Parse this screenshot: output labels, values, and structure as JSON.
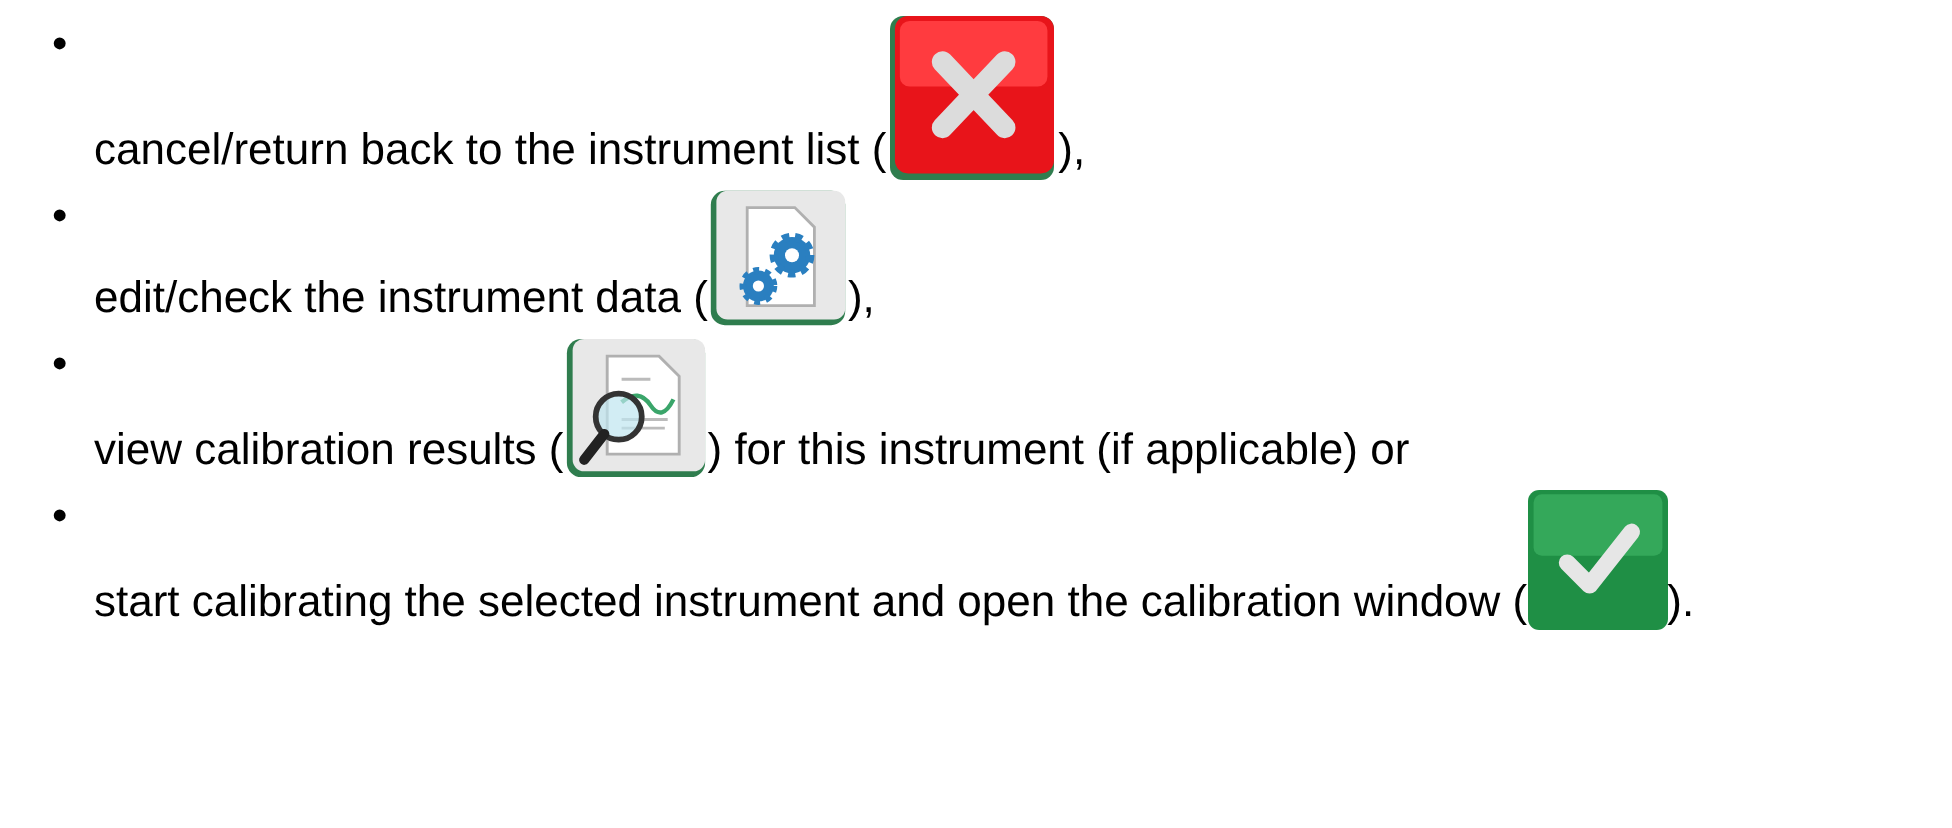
{
  "items": [
    {
      "text_before": "cancel/return back to the instrument list (",
      "icon": {
        "kind": "cancel"
      },
      "text_after": "),"
    },
    {
      "text_before": "edit/check the instrument data (",
      "icon": {
        "kind": "edit"
      },
      "text_after": "),"
    },
    {
      "text_before": "view calibration results (",
      "icon": {
        "kind": "results"
      },
      "text_after": ") for this instrument (if applicable) or"
    },
    {
      "text_before": "start calibrating the selected instrument and open the calibration window (",
      "icon": {
        "kind": "calibrate"
      },
      "text_after": ")."
    }
  ],
  "bullet": "•"
}
